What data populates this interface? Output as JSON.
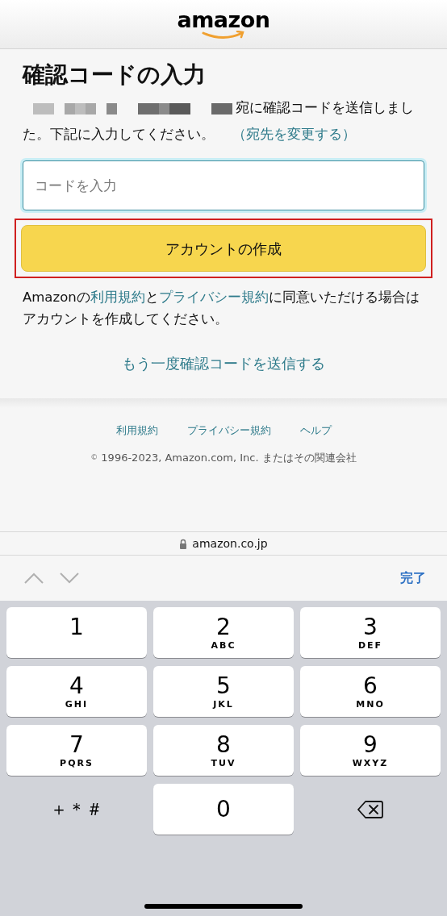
{
  "header": {
    "logo": "amazon"
  },
  "title": "確認コードの入力",
  "message": {
    "text": "宛に確認コードを送信しました。下記に入力してください。",
    "link": "（宛先を変更する）"
  },
  "code_field": {
    "placeholder": "コードを入力"
  },
  "create_button": {
    "label": "アカウントの作成",
    "highlighted": true
  },
  "agreement": [
    {
      "kind": "text",
      "text": "Amazonの"
    },
    {
      "kind": "link",
      "text": "利用規約"
    },
    {
      "kind": "text",
      "text": "と"
    },
    {
      "kind": "link",
      "text": "プライバシー規約"
    },
    {
      "kind": "text",
      "text": "に同意いただける場合はアカウントを作成してください。"
    }
  ],
  "resend_link": "もう一度確認コードを送信する",
  "footer": {
    "links": [
      "利用規約",
      "プライバシー規約",
      "ヘルプ"
    ],
    "copyright_mark": "©",
    "copyright": "1996-2023, Amazon.com, Inc. またはその関連会社"
  },
  "address_bar": {
    "url": "amazon.co.jp"
  },
  "keyboard_toolbar": {
    "done": "完了"
  },
  "keys": [
    {
      "kind": "digit",
      "digit": "1"
    },
    {
      "kind": "digit",
      "digit": "2",
      "letters": "ABC"
    },
    {
      "kind": "digit",
      "digit": "3",
      "letters": "DEF"
    },
    {
      "kind": "digit",
      "digit": "4",
      "letters": "GHI"
    },
    {
      "kind": "digit",
      "digit": "5",
      "letters": "JKL"
    },
    {
      "kind": "digit",
      "digit": "6",
      "letters": "MNO"
    },
    {
      "kind": "digit",
      "digit": "7",
      "letters": "PQRS"
    },
    {
      "kind": "digit",
      "digit": "8",
      "letters": "TUV"
    },
    {
      "kind": "digit",
      "digit": "9",
      "letters": "WXYZ"
    },
    {
      "kind": "symbol",
      "label": "＋＊＃"
    },
    {
      "kind": "digit",
      "digit": "0"
    },
    {
      "kind": "delete"
    }
  ]
}
